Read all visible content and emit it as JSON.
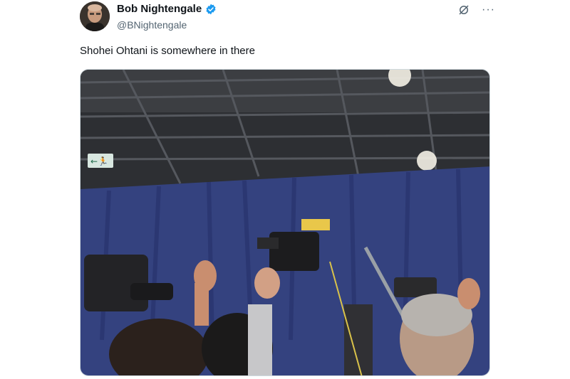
{
  "author": {
    "name": "Bob Nightengale",
    "handle": "@BNightengale",
    "verified": true,
    "avatar_icon": "profile-photo"
  },
  "tweet": {
    "text": "Shohei Ohtani is somewhere in there"
  },
  "header_actions": {
    "grok_icon": "grok-icon",
    "more_icon": "more-icon",
    "more_label": "···"
  },
  "media": {
    "description_icon": "photo",
    "exit_sign_label": "←🏃"
  },
  "colors": {
    "verified_blue": "#1d9bf0",
    "text_primary": "#0f1419",
    "text_secondary": "#536471",
    "curtain": "#2f3b78"
  }
}
